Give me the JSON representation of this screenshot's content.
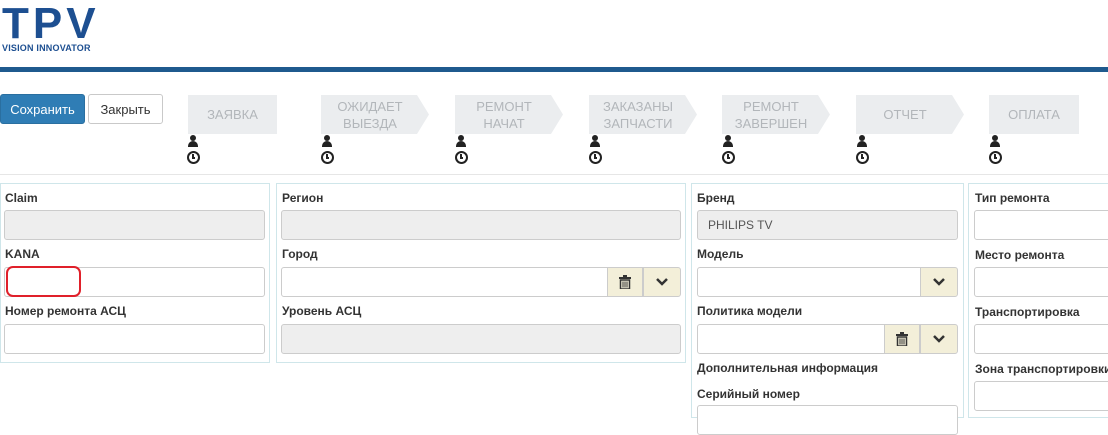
{
  "logo": {
    "main": "TPV",
    "sub": "VISION INNOVATOR"
  },
  "toolbar": {
    "save_label": "Сохранить",
    "close_label": "Закрыть"
  },
  "steps": [
    {
      "line1": "ЗАЯВКА",
      "line2": ""
    },
    {
      "line1": "ОЖИДАЕТ",
      "line2": "ВЫЕЗДА"
    },
    {
      "line1": "РЕМОНТ",
      "line2": "НАЧАТ"
    },
    {
      "line1": "ЗАКАЗАНЫ",
      "line2": "ЗАПЧАСТИ"
    },
    {
      "line1": "РЕМОНТ",
      "line2": "ЗАВЕРШЕН"
    },
    {
      "line1": "ОТЧЕТ",
      "line2": ""
    },
    {
      "line1": "ОПЛАТА",
      "line2": ""
    }
  ],
  "panel1": {
    "claim_label": "Claim",
    "claim_value": "",
    "kana_label": "KANA",
    "kana_value": "",
    "repair_no_label": "Номер ремонта АСЦ",
    "repair_no_value": ""
  },
  "panel2": {
    "region_label": "Регион",
    "region_value": "",
    "city_label": "Город",
    "city_value": "",
    "level_label": "Уровень АСЦ",
    "level_value": ""
  },
  "panel3": {
    "brand_label": "Бренд",
    "brand_value": "PHILIPS TV",
    "model_label": "Модель",
    "model_value": "",
    "policy_label": "Политика модели",
    "policy_value": "",
    "extra_label": "Дополнительная информация",
    "serial_label": "Серийный номер"
  },
  "panel4": {
    "type_label": "Тип ремонта",
    "place_label": "Место ремонта",
    "transport_label": "Транспортировка",
    "zone_label": "Зона транспортировки"
  }
}
